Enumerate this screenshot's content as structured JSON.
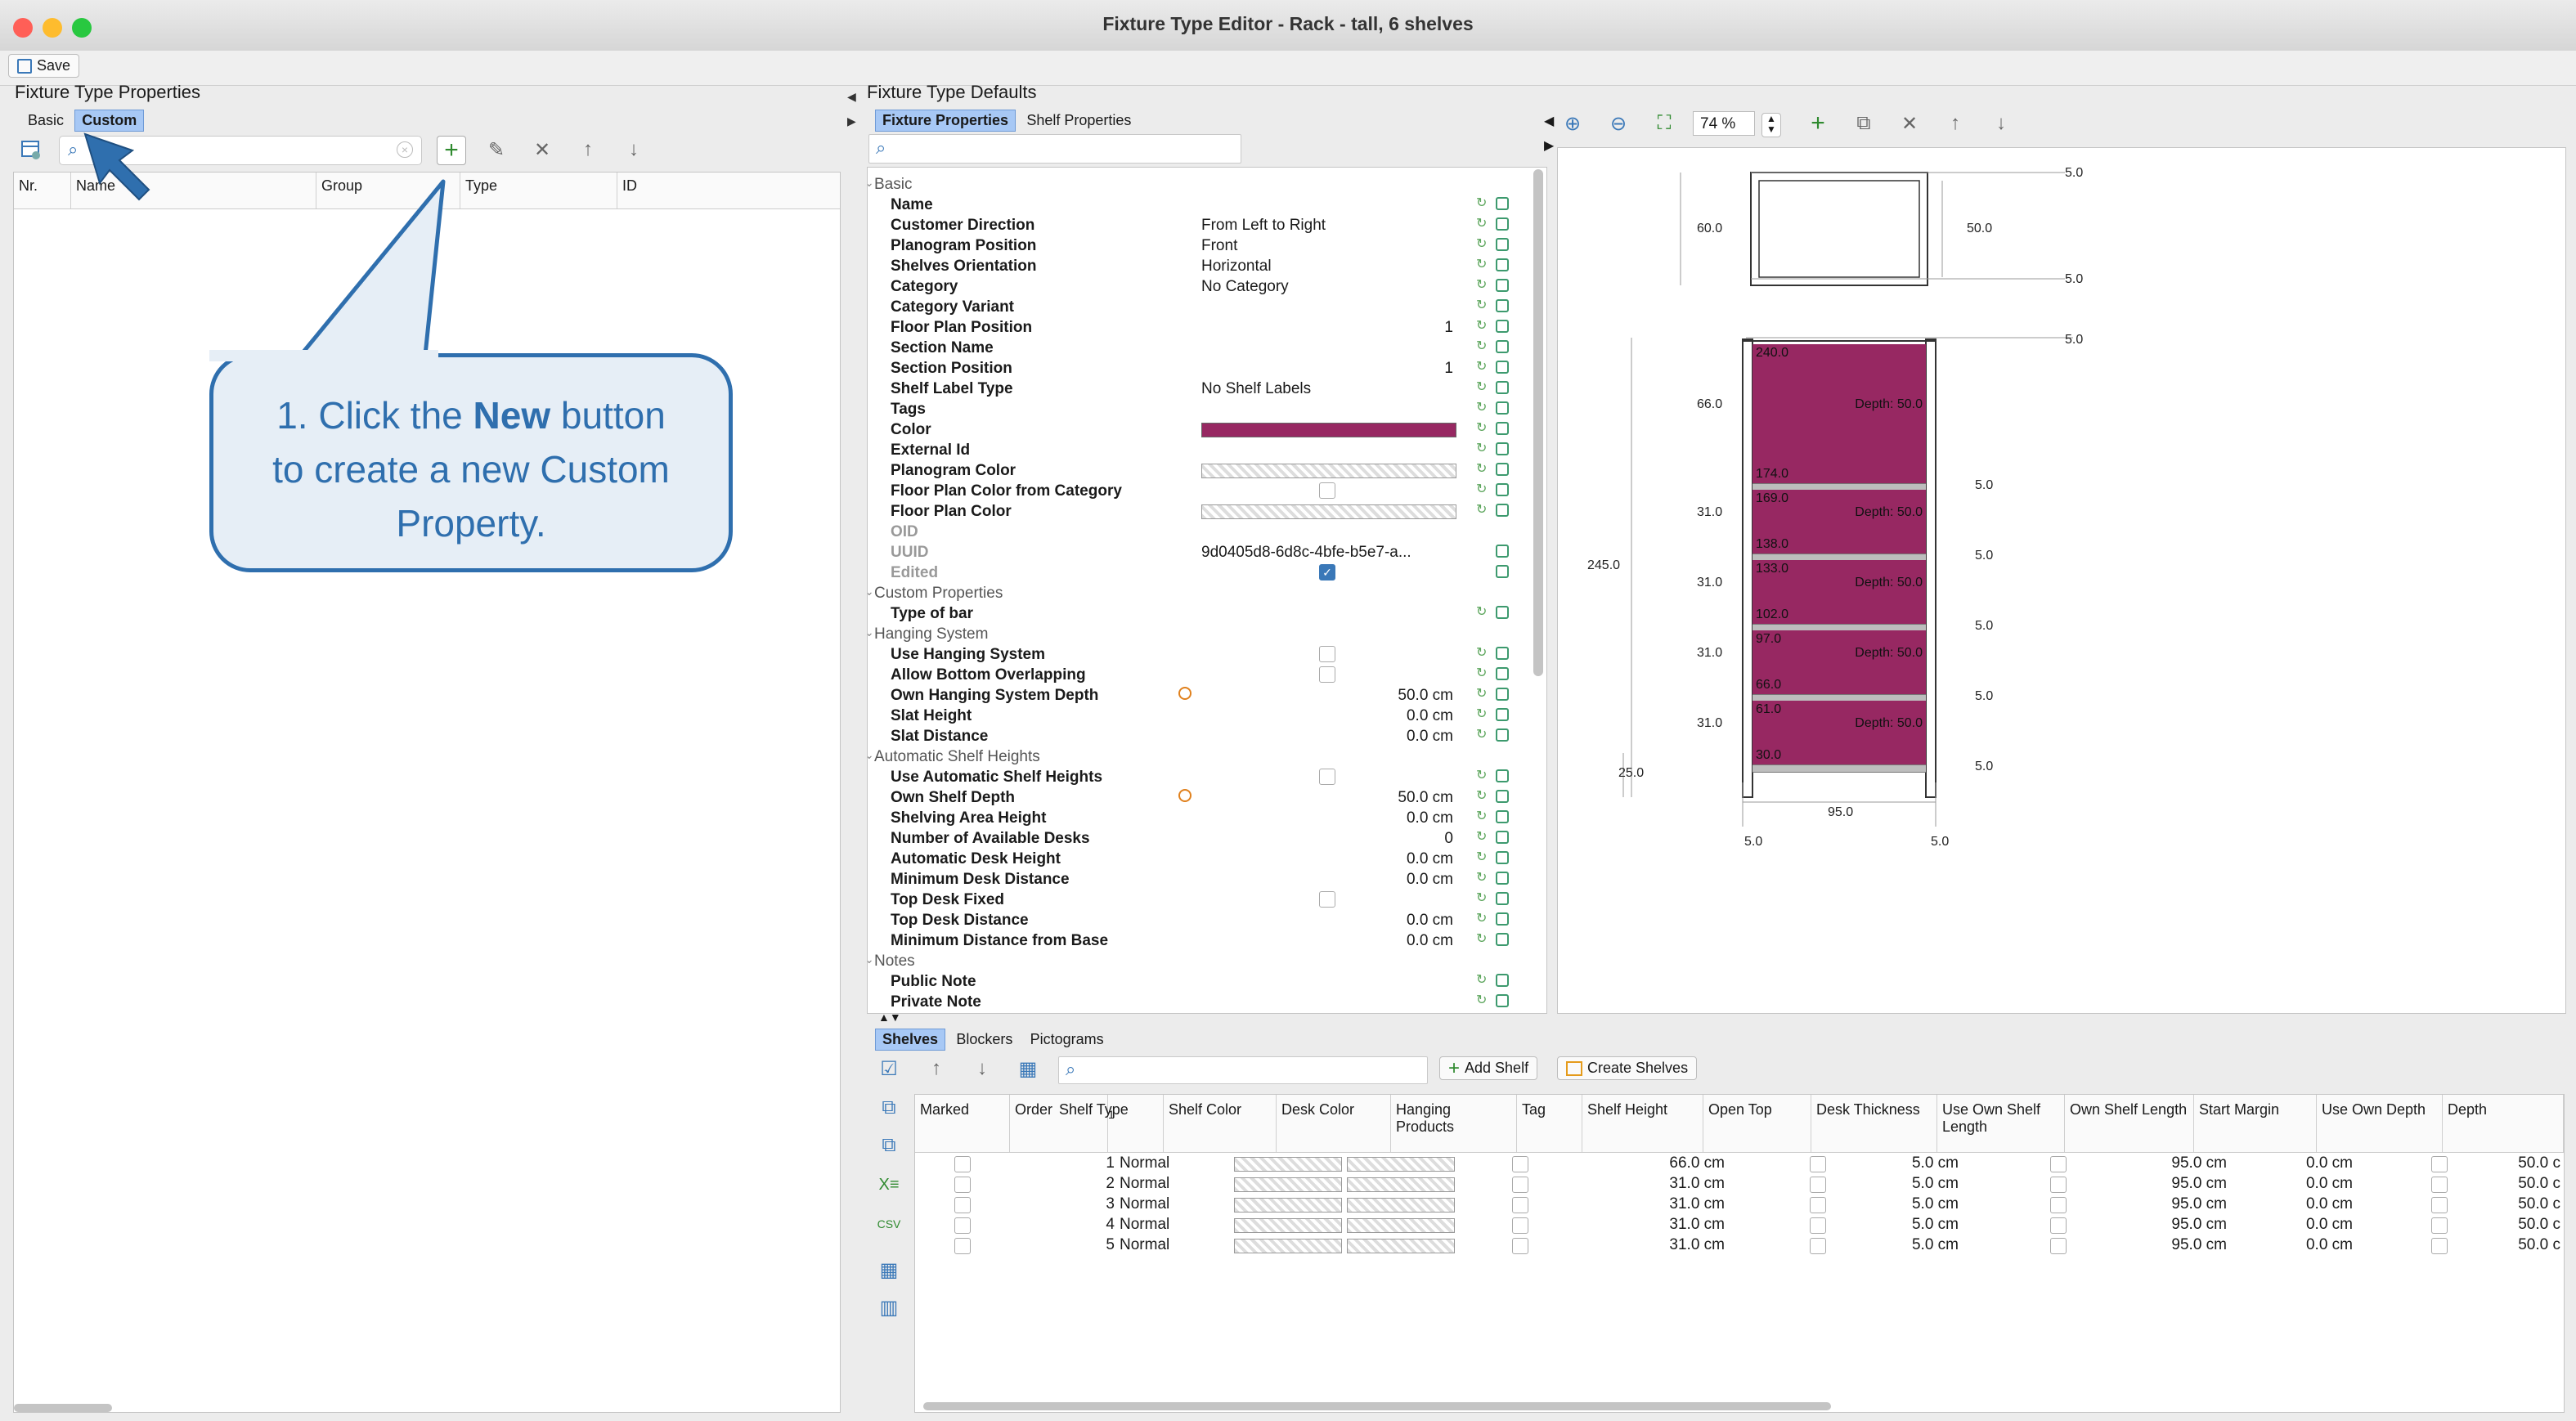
{
  "window": {
    "title": "Fixture Type Editor - Rack - tall, 6 shelves",
    "lights": [
      "#ff5f57",
      "#febc2e",
      "#28c840"
    ]
  },
  "toolbar": {
    "save_label": "Save"
  },
  "left_panel": {
    "title": "Fixture Type Properties",
    "tabs": [
      "Basic",
      "Custom"
    ],
    "active_tab": "Custom",
    "columns": [
      "Nr.",
      "Name",
      "Group",
      "Type",
      "ID"
    ]
  },
  "callout": {
    "line1_pre": "1. Click the ",
    "line1_bold": "New",
    "line1_post": " button",
    "line2": "to create a new Custom",
    "line3": "Property."
  },
  "right_panel": {
    "title": "Fixture Type Defaults",
    "tabs": [
      "Fixture Properties",
      "Shelf Properties"
    ],
    "active_tab": "Fixture Properties"
  },
  "properties": [
    {
      "type": "section",
      "label": "Basic"
    },
    {
      "label": "Name",
      "value": ""
    },
    {
      "label": "Customer Direction",
      "value": "From Left to Right"
    },
    {
      "label": "Planogram Position",
      "value": "Front"
    },
    {
      "label": "Shelves Orientation",
      "value": "Horizontal"
    },
    {
      "label": "Category",
      "value": "No Category"
    },
    {
      "label": "Category Variant",
      "value": ""
    },
    {
      "label": "Floor Plan Position",
      "value_right": "1"
    },
    {
      "label": "Section Name",
      "value": ""
    },
    {
      "label": "Section Position",
      "value_right": "1"
    },
    {
      "label": "Shelf Label Type",
      "value": "No Shelf Labels"
    },
    {
      "label": "Tags",
      "value": ""
    },
    {
      "label": "Color",
      "swatch": "#972862"
    },
    {
      "label": "External Id",
      "value": ""
    },
    {
      "label": "Planogram Color",
      "pattern": true
    },
    {
      "label": "Floor Plan Color from Category",
      "checkbox": false
    },
    {
      "label": "Floor Plan Color",
      "pattern": true
    },
    {
      "label": "OID",
      "value": "",
      "grey": true
    },
    {
      "label": "UUID",
      "value": "9d0405d8-6d8c-4bfe-b5e7-a...",
      "grey": true
    },
    {
      "label": "Edited",
      "checkbox": true,
      "grey": true
    },
    {
      "type": "section",
      "label": "Custom Properties"
    },
    {
      "label": "Type of bar",
      "value": ""
    },
    {
      "type": "section",
      "label": "Hanging System"
    },
    {
      "label": "Use Hanging System",
      "checkbox": false
    },
    {
      "label": "Allow Bottom Overlapping",
      "checkbox": false
    },
    {
      "label": "Own Hanging System Depth",
      "value_right": "50.0 cm",
      "warn": true
    },
    {
      "label": "Slat Height",
      "value_right": "0.0 cm"
    },
    {
      "label": "Slat Distance",
      "value_right": "0.0 cm"
    },
    {
      "type": "section",
      "label": "Automatic Shelf Heights"
    },
    {
      "label": "Use Automatic Shelf Heights",
      "checkbox": false
    },
    {
      "label": "Own Shelf Depth",
      "value_right": "50.0 cm",
      "warn": true
    },
    {
      "label": "Shelving Area Height",
      "value_right": "0.0 cm"
    },
    {
      "label": "Number of Available Desks",
      "value_right": "0"
    },
    {
      "label": "Automatic Desk Height",
      "value_right": "0.0 cm"
    },
    {
      "label": "Minimum Desk Distance",
      "value_right": "0.0 cm"
    },
    {
      "label": "Top Desk Fixed",
      "checkbox": false
    },
    {
      "label": "Top Desk Distance",
      "value_right": "0.0 cm"
    },
    {
      "label": "Minimum Distance from Base",
      "value_right": "0.0 cm"
    },
    {
      "type": "section",
      "label": "Notes"
    },
    {
      "label": "Public Note",
      "value": ""
    },
    {
      "label": "Private Note",
      "value": ""
    }
  ],
  "preview": {
    "zoom": "74 %",
    "top_dims": {
      "h": "60.0",
      "inner": "50.0",
      "top": "5.0",
      "bottom": "5.0"
    },
    "side_dims": {
      "total": "245.0",
      "base": "25.0",
      "width": "95.0",
      "left": "5.0",
      "right": "5.0",
      "top": "5.0"
    },
    "shelves": [
      {
        "top": "240.0",
        "bottom": "174.0",
        "depth": "Depth: 50.0",
        "height": "66.0",
        "thick": "5.0"
      },
      {
        "top": "169.0",
        "bottom": "138.0",
        "depth": "Depth: 50.0",
        "height": "31.0",
        "thick": "5.0"
      },
      {
        "top": "133.0",
        "bottom": "102.0",
        "depth": "Depth: 50.0",
        "height": "31.0",
        "thick": "5.0"
      },
      {
        "top": "97.0",
        "bottom": "66.0",
        "depth": "Depth: 50.0",
        "height": "31.0",
        "thick": "5.0"
      },
      {
        "top": "61.0",
        "bottom": "30.0",
        "depth": "Depth: 50.0",
        "height": "31.0",
        "thick": "5.0"
      }
    ]
  },
  "bottom": {
    "tabs": [
      "Shelves",
      "Blockers",
      "Pictograms"
    ],
    "active_tab": "Shelves",
    "add_shelf": "Add Shelf",
    "create_shelves": "Create Shelves",
    "columns": [
      "Marked",
      "Order",
      "Shelf Type",
      "Shelf Color",
      "Desk Color",
      "Hanging Products",
      "Tag",
      "Shelf Height",
      "Open Top",
      "Desk Thickness",
      "Use Own Shelf Length",
      "Own Shelf Length",
      "Start Margin",
      "Use Own Depth",
      "Depth"
    ],
    "sort_indicator": "1",
    "rows": [
      {
        "order": "1",
        "type": "Normal",
        "height": "66.0 cm",
        "thick": "5.0 cm",
        "length": "95.0 cm",
        "margin": "0.0 cm",
        "depth": "50.0 c"
      },
      {
        "order": "2",
        "type": "Normal",
        "height": "31.0 cm",
        "thick": "5.0 cm",
        "length": "95.0 cm",
        "margin": "0.0 cm",
        "depth": "50.0 c"
      },
      {
        "order": "3",
        "type": "Normal",
        "height": "31.0 cm",
        "thick": "5.0 cm",
        "length": "95.0 cm",
        "margin": "0.0 cm",
        "depth": "50.0 c"
      },
      {
        "order": "4",
        "type": "Normal",
        "height": "31.0 cm",
        "thick": "5.0 cm",
        "length": "95.0 cm",
        "margin": "0.0 cm",
        "depth": "50.0 c"
      },
      {
        "order": "5",
        "type": "Normal",
        "height": "31.0 cm",
        "thick": "5.0 cm",
        "length": "95.0 cm",
        "margin": "0.0 cm",
        "depth": "50.0 c"
      }
    ]
  },
  "colors": {
    "accent": "#3a78b8",
    "shelf": "#972862",
    "tab_active": "#a7c8f5"
  }
}
